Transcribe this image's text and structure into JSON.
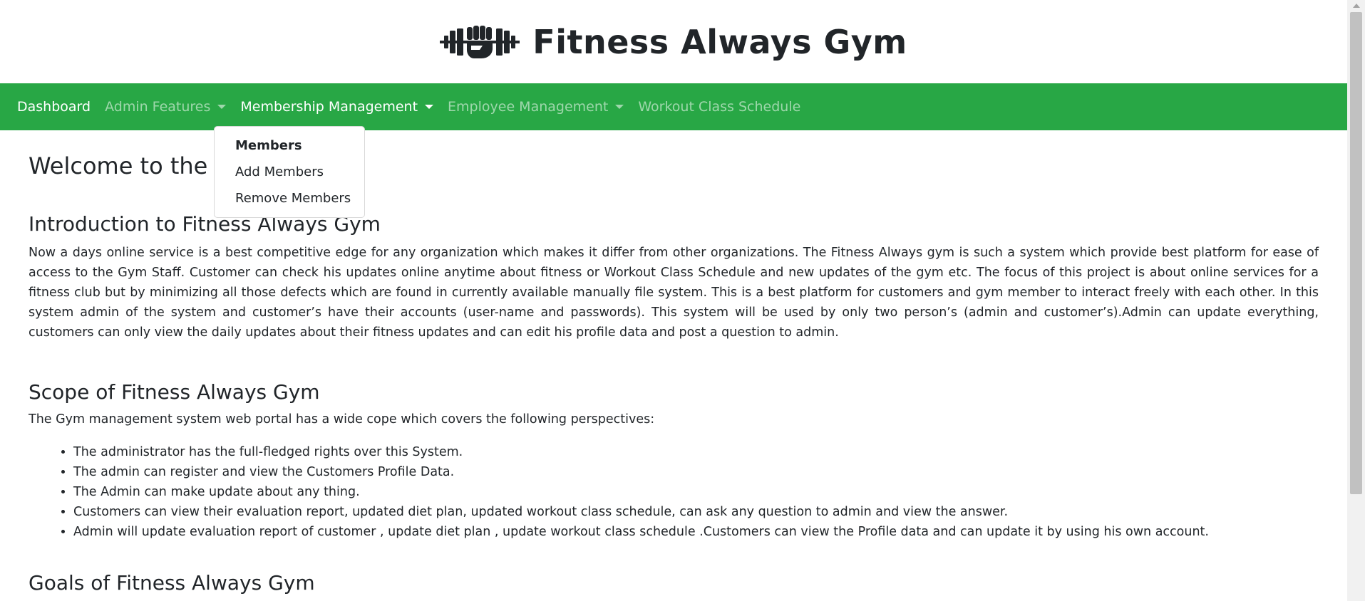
{
  "header": {
    "logo_icon": "dumbbell-fist-icon",
    "title": "Fitness Always Gym"
  },
  "navbar": {
    "background": "#28a745",
    "items": [
      {
        "label": "Dashboard",
        "active": true,
        "dropdown": false
      },
      {
        "label": "Admin Features",
        "active": false,
        "dropdown": true
      },
      {
        "label": "Membership Management",
        "active": true,
        "dropdown": true
      },
      {
        "label": "Employee Management",
        "active": false,
        "dropdown": true
      },
      {
        "label": "Workout Class Schedule",
        "active": false,
        "dropdown": false
      }
    ]
  },
  "dropdown": {
    "items": [
      {
        "label": "Members"
      },
      {
        "label": "Add Members"
      },
      {
        "label": "Remove Members"
      }
    ]
  },
  "main": {
    "welcome": "Welcome to the Dashboard",
    "intro": {
      "title": "Introduction to Fitness Always Gym",
      "text": "Now a days online service is a best competitive edge for any organization which makes it differ from other organizations. The Fitness Always gym is such a system which provide best platform for ease of access to the Gym Staff. Customer can check his updates online anytime about fitness or Workout Class Schedule and new updates of the gym etc. The focus of this project is about online services for a fitness club but by minimizing all those defects which are found in currently available manually file system. This is a best platform for customers and gym member to interact freely with each other. In this system admin of the system and customer’s have their accounts (user-name and passwords). This system will be used by only two person’s (admin and customer’s).Admin can update everything, customers can only view the daily updates about their fitness updates and can edit his profile data and post a question to admin."
    },
    "scope": {
      "title": "Scope of Fitness Always Gym",
      "description": "The Gym management system web portal has a wide cope which covers the following perspectives:",
      "items": [
        "The administrator has the full-fledged rights over this System.",
        "The admin can register and view the Customers Profile Data.",
        "The Admin can make update about any thing.",
        "Customers can view their evaluation report, updated diet plan, updated workout class schedule, can ask any question to admin and view the answer.",
        "Admin will update evaluation report of customer , update diet plan , update workout class schedule .Customers can view the Profile data and can update it by using his own account."
      ]
    },
    "goals": {
      "title": "Goals of Fitness Always Gym"
    }
  }
}
